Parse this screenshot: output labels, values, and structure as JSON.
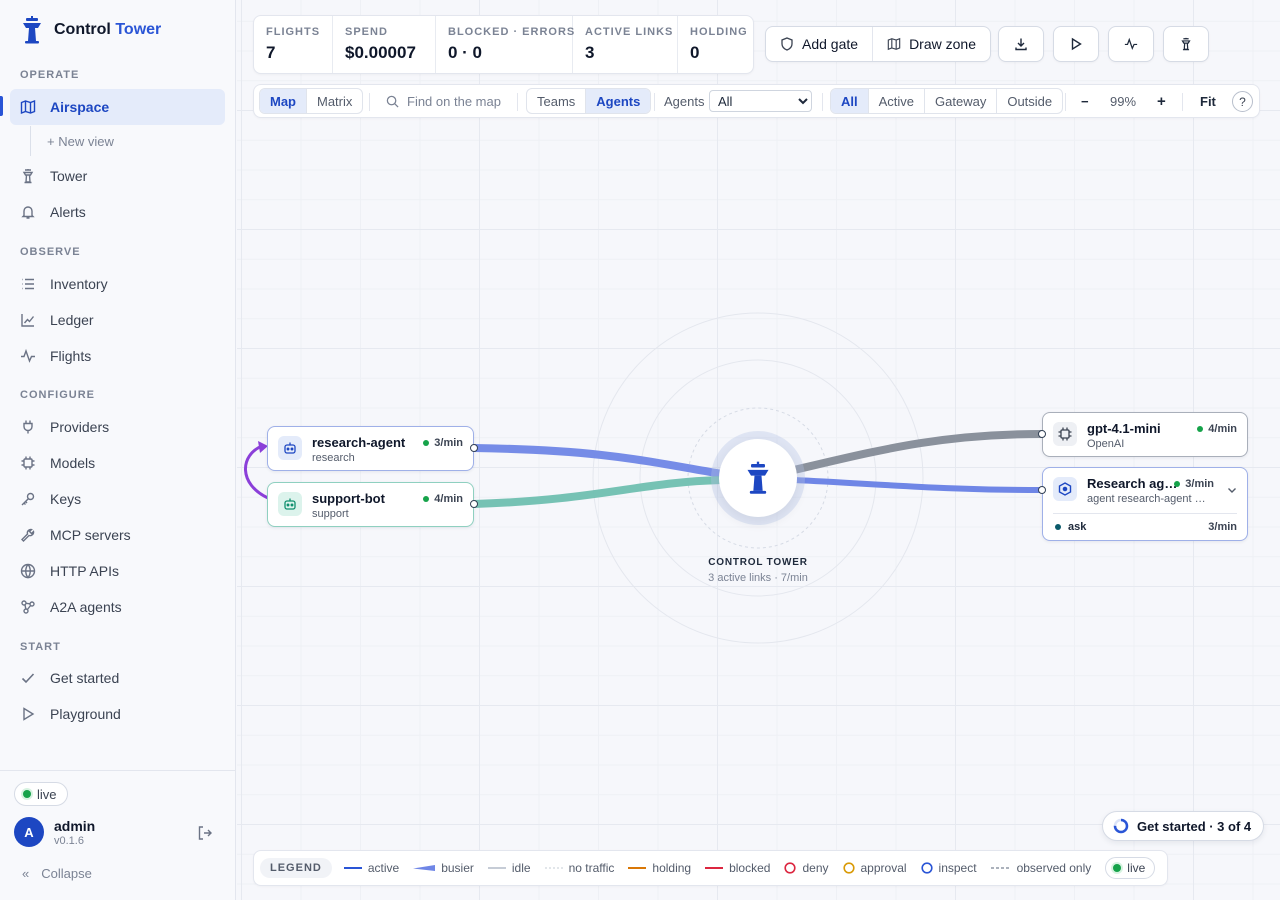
{
  "brand": {
    "name": "Control",
    "accent": "Tower",
    "accent_color": "#2a55d6"
  },
  "sidebar": {
    "sections": [
      {
        "label": "OPERATE"
      },
      {
        "label": "OBSERVE"
      },
      {
        "label": "CONFIGURE"
      },
      {
        "label": "START"
      }
    ],
    "items": [
      {
        "label": "Airspace",
        "icon": "map-icon",
        "active": true
      },
      {
        "label": "+ New view"
      },
      {
        "label": "Tower",
        "icon": "tower-icon"
      },
      {
        "label": "Alerts",
        "icon": "bell-icon"
      },
      {
        "label": "Inventory",
        "icon": "list-icon"
      },
      {
        "label": "Ledger",
        "icon": "chart-line-icon"
      },
      {
        "label": "Flights",
        "icon": "pulse-icon"
      },
      {
        "label": "Providers",
        "icon": "plug-icon"
      },
      {
        "label": "Models",
        "icon": "chip-icon"
      },
      {
        "label": "Keys",
        "icon": "key-icon"
      },
      {
        "label": "MCP servers",
        "icon": "wrench-icon"
      },
      {
        "label": "HTTP APIs",
        "icon": "globe-icon"
      },
      {
        "label": "A2A agents",
        "icon": "nodes-icon"
      },
      {
        "label": "Get started",
        "icon": "check-icon"
      },
      {
        "label": "Playground",
        "icon": "play-icon"
      }
    ],
    "live": "live",
    "user": {
      "initial": "A",
      "name": "admin",
      "version": "v0.1.6"
    },
    "collapse": "Collapse"
  },
  "stats": [
    {
      "label": "FLIGHTS",
      "value": "7"
    },
    {
      "label": "SPEND",
      "value": "$0.00007"
    },
    {
      "label": "BLOCKED · ERRORS",
      "value": "0 · 0"
    },
    {
      "label": "ACTIVE LINKS",
      "value": "3"
    },
    {
      "label": "HOLDING",
      "value": "0"
    }
  ],
  "actions": {
    "add_gate": "Add gate",
    "draw_zone": "Draw zone"
  },
  "toolbar": {
    "view": [
      "Map",
      "Matrix"
    ],
    "view_selected": "Map",
    "search_placeholder": "Find on the map",
    "group": [
      "Teams",
      "Agents"
    ],
    "group_selected": "Agents",
    "agents_label": "Agents",
    "agents_select": [
      "All"
    ],
    "filter": [
      "All",
      "Active",
      "Gateway",
      "Outside"
    ],
    "filter_selected": "All",
    "zoom_minus": "−",
    "zoom_value": "99%",
    "zoom_plus": "+",
    "fit": "Fit",
    "help": "?"
  },
  "map": {
    "tower": {
      "label": "CONTROL TOWER",
      "sub": "3 active links · 7/min"
    },
    "nodes": {
      "research_agent": {
        "title": "research-agent",
        "sub": "research",
        "rate": "3/min"
      },
      "support_bot": {
        "title": "support-bot",
        "sub": "support",
        "rate": "4/min"
      },
      "gpt": {
        "title": "gpt-4.1-mini",
        "sub": "OpenAI",
        "rate": "4/min"
      },
      "research_ag": {
        "title": "Research ag…",
        "sub": "agent research-agent …",
        "rate": "3/min",
        "skill": "ask",
        "skill_rate": "3/min"
      }
    },
    "colors": {
      "blue_link": "#6f86e6",
      "teal_link": "#6fbfb0",
      "gray_link": "#8a919c",
      "loop": "#8b3fd9"
    }
  },
  "legend": {
    "title": "LEGEND",
    "items": [
      {
        "label": "active",
        "color": "#2a55d6"
      },
      {
        "label": "busier",
        "color": "#6f86e6"
      },
      {
        "label": "idle",
        "color": "#c6ccd6"
      },
      {
        "label": "no traffic",
        "color": "#c6ccd6"
      },
      {
        "label": "holding",
        "color": "#d97706"
      },
      {
        "label": "blocked",
        "color": "#dc2640"
      },
      {
        "label": "deny",
        "color": "#dc2640"
      },
      {
        "label": "approval",
        "color": "#d99a06"
      },
      {
        "label": "inspect",
        "color": "#2a55d6"
      },
      {
        "label": "observed only",
        "color": "#7b8394"
      }
    ],
    "live": "live"
  },
  "get_started": "Get started · 3 of 4"
}
